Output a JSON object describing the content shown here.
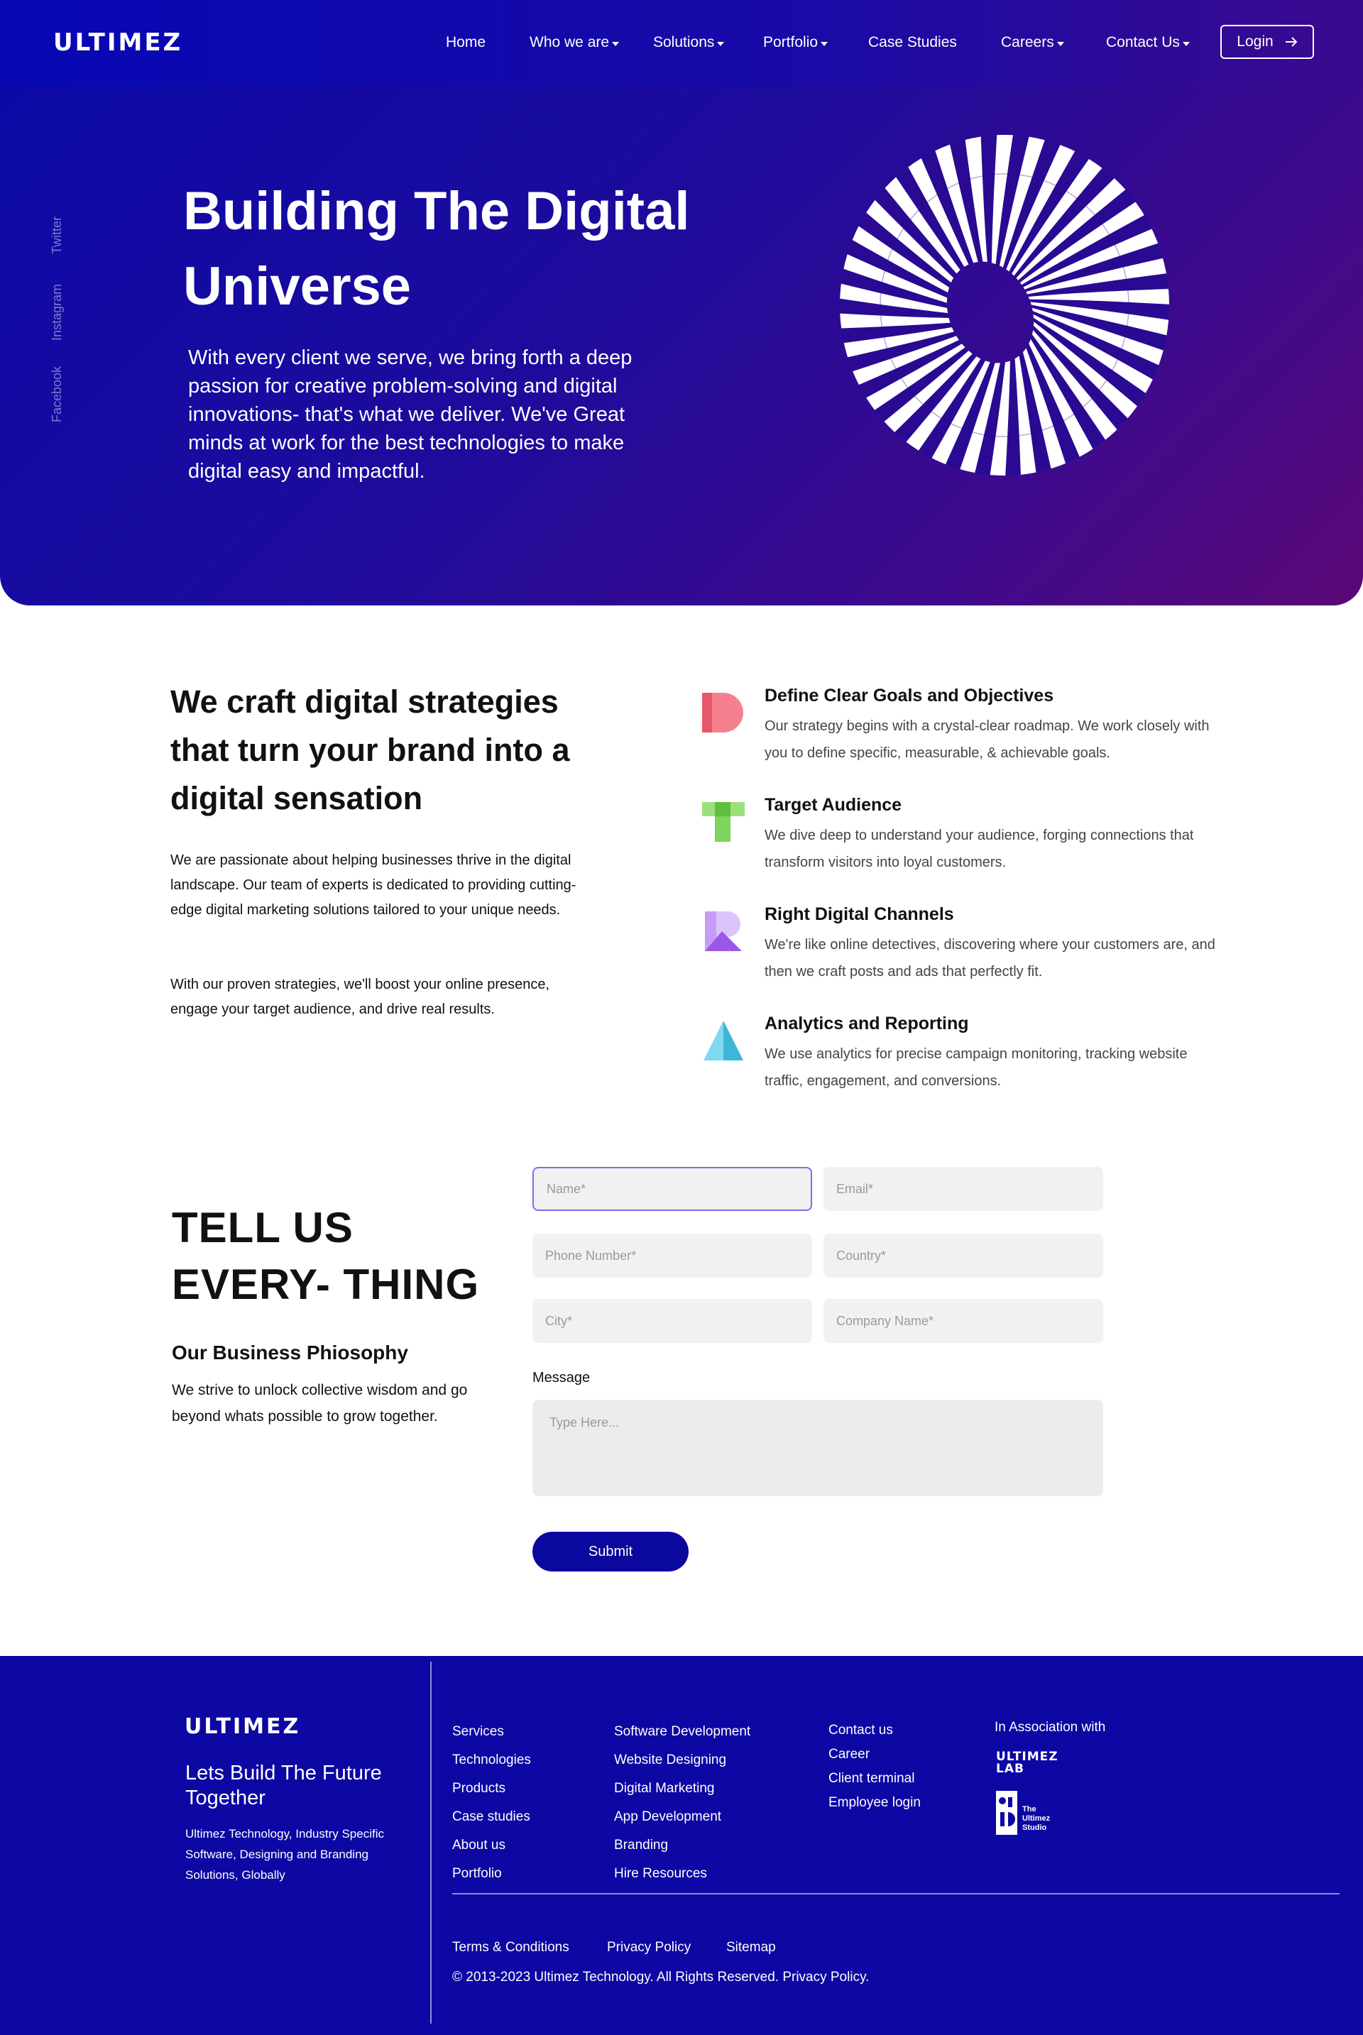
{
  "header": {
    "logo": "ULTIMEZ",
    "nav": [
      {
        "label": "Home",
        "dropdown": false
      },
      {
        "label": "Who we are",
        "dropdown": true
      },
      {
        "label": "Solutions",
        "dropdown": true
      },
      {
        "label": "Portfolio",
        "dropdown": true
      },
      {
        "label": "Case Studies",
        "dropdown": false
      },
      {
        "label": "Careers",
        "dropdown": true
      },
      {
        "label": "Contact Us",
        "dropdown": true
      }
    ],
    "login_label": "Login"
  },
  "social": [
    "Twitter",
    "Instagram",
    "Facebook"
  ],
  "hero": {
    "title_line1": "Building The Digital",
    "title_line2": "Universe",
    "text": "With every client we serve, we bring forth a deep passion for creative problem-solving and digital innovations- that's what we deliver. We've Great minds at work for the best technologies to make digital easy and impactful."
  },
  "strategy": {
    "title": "We craft digital strategies that turn your brand into a digital sensation",
    "para1": "We are passionate about helping businesses thrive in the digital landscape. Our team of experts is dedicated to providing cutting-edge digital marketing solutions tailored to your unique needs.",
    "para2": "With our proven strategies, we'll boost your online presence, engage your target audience, and drive real results.",
    "features": [
      {
        "title": "Define Clear Goals and Objectives",
        "desc": "Our strategy begins with a crystal-clear roadmap. We work closely with you to define specific, measurable, & achievable goals.",
        "icon": "letter-d-icon",
        "color": "#f5707f"
      },
      {
        "title": "Target Audience",
        "desc": "We dive deep to understand your audience, forging connections that transform visitors into loyal customers.",
        "icon": "letter-t-icon",
        "color": "#7fd45d"
      },
      {
        "title": "Right Digital Channels",
        "desc": "We're like online detectives, discovering where your customers are, and then we craft posts and ads that perfectly fit.",
        "icon": "letter-r-icon",
        "color": "#b47af0"
      },
      {
        "title": "Analytics and Reporting",
        "desc": "We use analytics for precise campaign monitoring, tracking website traffic, engagement, and conversions.",
        "icon": "triangle-icon",
        "color": "#5ccbe8"
      }
    ]
  },
  "contact": {
    "title_line1": "TELL US",
    "title_line2": "EVERY- THING",
    "philosophy_title": "Our Business Phiosophy",
    "philosophy_text": "We strive to unlock collective wisdom and go beyond whats possible to grow together.",
    "placeholders": {
      "name": "Name*",
      "email": "Email*",
      "phone": "Phone Number*",
      "country": "Country*",
      "city": "City*",
      "company": "Company Name*",
      "message": "Type Here..."
    },
    "message_label": "Message",
    "submit_label": "Submit"
  },
  "footer": {
    "logo": "ULTIMEZ",
    "tagline": "Lets Build The Future Together",
    "description": "Ultimez Technology, Industry  Specific Software, Designing and Branding Solutions, Globally",
    "col1": [
      "Services",
      "Technologies",
      "Products",
      "Case studies",
      "About us",
      "Portfolio"
    ],
    "col2": [
      "Software Development",
      "Website Designing",
      "Digital Marketing",
      "App Development",
      "Branding",
      " Hire Resources"
    ],
    "col3": [
      "Contact us",
      "Career",
      "Client terminal",
      "Employee login"
    ],
    "association_label": "In Association with",
    "lab_logo_line1": "ULTIMEZ",
    "lab_logo_line2": "LAB",
    "studio_line1": "The",
    "studio_line2": "Ultimez",
    "studio_line3": "Studio",
    "bottom_links": [
      "Terms & Conditions",
      "Privacy Policy",
      "Sitemap"
    ],
    "copyright": "© 2013-2023 Ultimez Technology. All Rights Reserved. Privacy Policy."
  },
  "colors": {
    "primary": "#0b089e",
    "hero_start": "#0a0aa8",
    "hero_end": "#5a0775",
    "torus_stripe": "#2a0a93"
  }
}
